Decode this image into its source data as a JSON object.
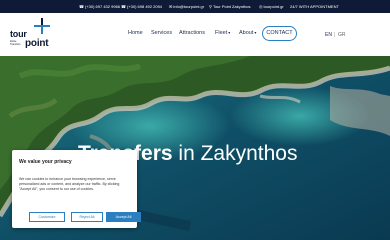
{
  "topbar": {
    "phone1": "(+30) 697 432 9966",
    "phone2": "(+30) 698 492 2094",
    "email": "info@tourpoint.gr",
    "location": "Tour Point Zakynthos",
    "social": "tourpoint.gr",
    "availability": "24/7 WITH APPOINTMENT"
  },
  "logo": {
    "word1": "tour",
    "word2": "point",
    "tagline": "Zante Transfers"
  },
  "nav": {
    "home": "Home",
    "services": "Services",
    "attractions": "Attractions",
    "fleet": "Fleet",
    "about": "About",
    "contact": "CONTACT",
    "lang_en": "EN",
    "lang_sep": "|",
    "lang_gr": "GR"
  },
  "hero": {
    "title_bold": "Transfers",
    "title_rest": " in Zakynthos"
  },
  "cookie": {
    "title": "We value your privacy",
    "text": "We use cookies to enhance your browsing experience, serve personalized ads or content, and analyze our traffic. By clicking \"Accept All\", you consent to our use of cookies.",
    "customize": "Customize",
    "reject": "Reject All",
    "accept": "Accept All"
  },
  "colors": {
    "topbar_bg": "#0f1a36",
    "accent": "#2a7fc1",
    "navy": "#1d2b4f"
  }
}
